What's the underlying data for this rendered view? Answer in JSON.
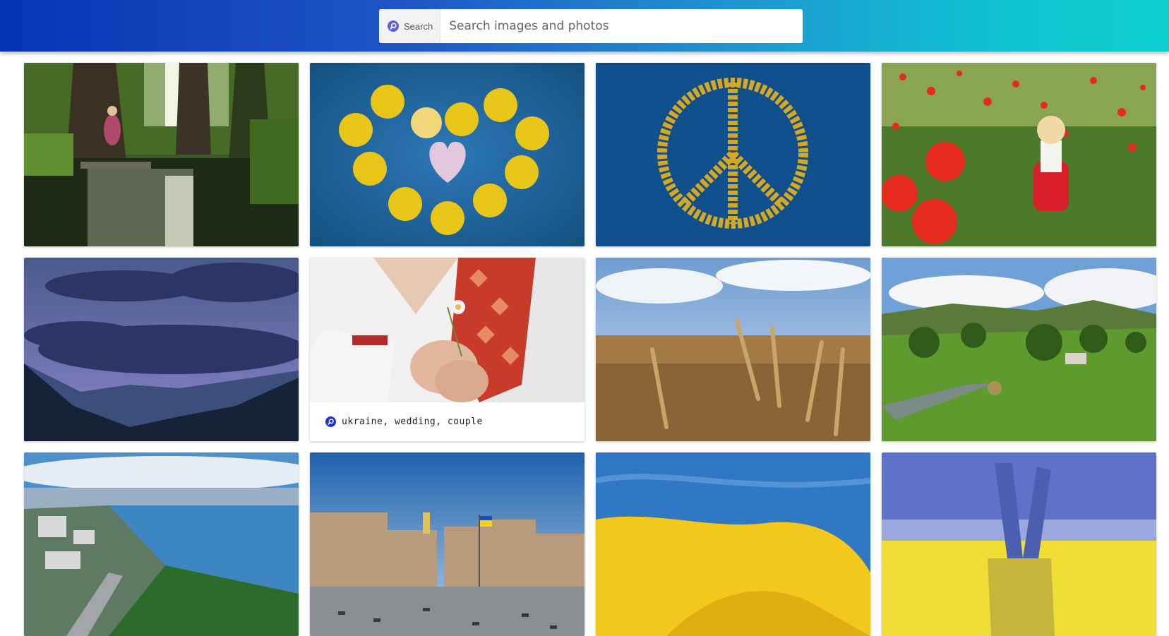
{
  "header": {
    "search_button_label": "Search",
    "search_placeholder": "Search images and photos",
    "search_icon": "search-icon",
    "gradient_colors": [
      "#0634b3",
      "#1f8fd0",
      "#0ccfce"
    ]
  },
  "gallery": {
    "hovered_caption": "ukraine, wedding, couple",
    "caption_icon": "search-icon",
    "photos": [
      {
        "subject": "girl-by-forest-stream"
      },
      {
        "subject": "yellow-flowers-heart-on-blue"
      },
      {
        "subject": "flower-petal-peace-sign-on-blue"
      },
      {
        "subject": "girl-in-poppy-field"
      },
      {
        "subject": "stormy-sky-over-mountains"
      },
      {
        "subject": "embroidered-shirt-hands-with-daisy"
      },
      {
        "subject": "wheat-field"
      },
      {
        "subject": "green-village-hills"
      },
      {
        "subject": "kyiv-river-view"
      },
      {
        "subject": "kyiv-independence-square"
      },
      {
        "subject": "ukraine-flag-waving"
      },
      {
        "subject": "peace-hand-ukraine-colors"
      }
    ]
  }
}
